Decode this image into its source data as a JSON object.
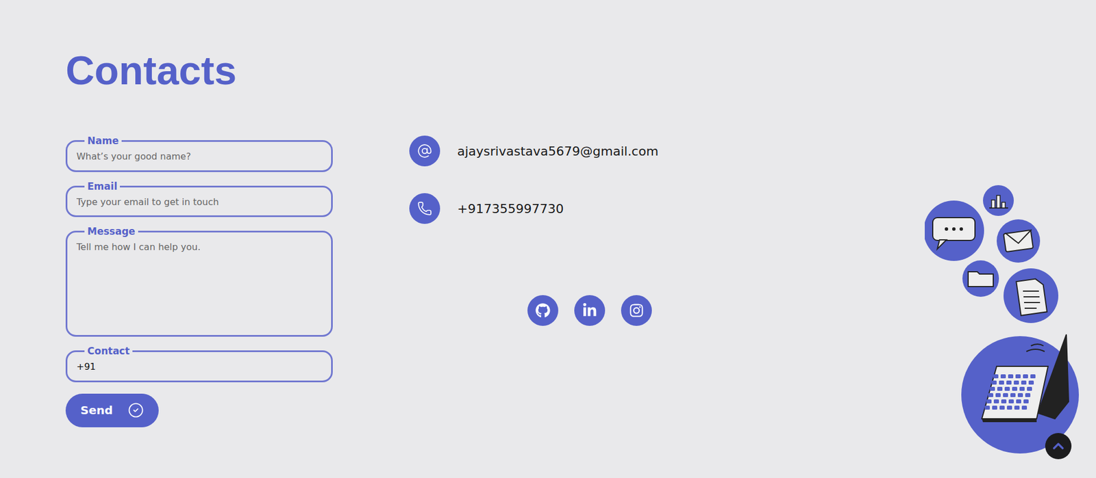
{
  "title": "Contacts",
  "form": {
    "fields": [
      {
        "label": "Name",
        "placeholder": "What’s your good name?",
        "value": "",
        "kind": "input"
      },
      {
        "label": "Email",
        "placeholder": "Type your email to get in touch",
        "value": "",
        "kind": "input"
      },
      {
        "label": "Message",
        "placeholder": "Tell me how I can help you.",
        "value": "",
        "kind": "textarea"
      },
      {
        "label": "Contact",
        "placeholder": "",
        "value": "+91",
        "kind": "input"
      }
    ],
    "submit": "Send"
  },
  "contacts": [
    {
      "kind": "email",
      "text": "ajaysrivastava5679@gmail.com"
    },
    {
      "kind": "phone",
      "text": "+917355997730"
    }
  ],
  "socials": [
    {
      "kind": "github"
    },
    {
      "kind": "linkedin"
    },
    {
      "kind": "instagram"
    }
  ]
}
